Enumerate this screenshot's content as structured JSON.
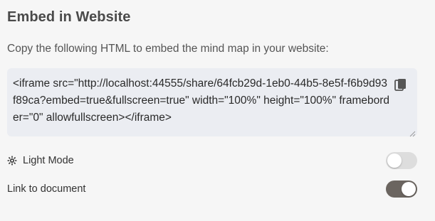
{
  "embed": {
    "title": "Embed in Website",
    "description": "Copy the following HTML to embed the mind map in your website:",
    "code": "<iframe src=\"http://localhost:44555/share/64fcb29d-1eb0-44b5-8e5f-f6b9d93f89ca?embed=true&fullscreen=true\" width=\"100%\" height=\"100%\" frameborder=\"0\" allowfullscreen></iframe>",
    "copy_icon": "copy-icon"
  },
  "settings": {
    "light_mode": {
      "label": "Light Mode",
      "icon": "gear-icon",
      "enabled": false
    },
    "link_to_document": {
      "label": "Link to document",
      "enabled": true
    }
  },
  "colors": {
    "toggle_on": "#6b6560",
    "toggle_off": "#dddddd",
    "code_background": "#ebedf2"
  }
}
